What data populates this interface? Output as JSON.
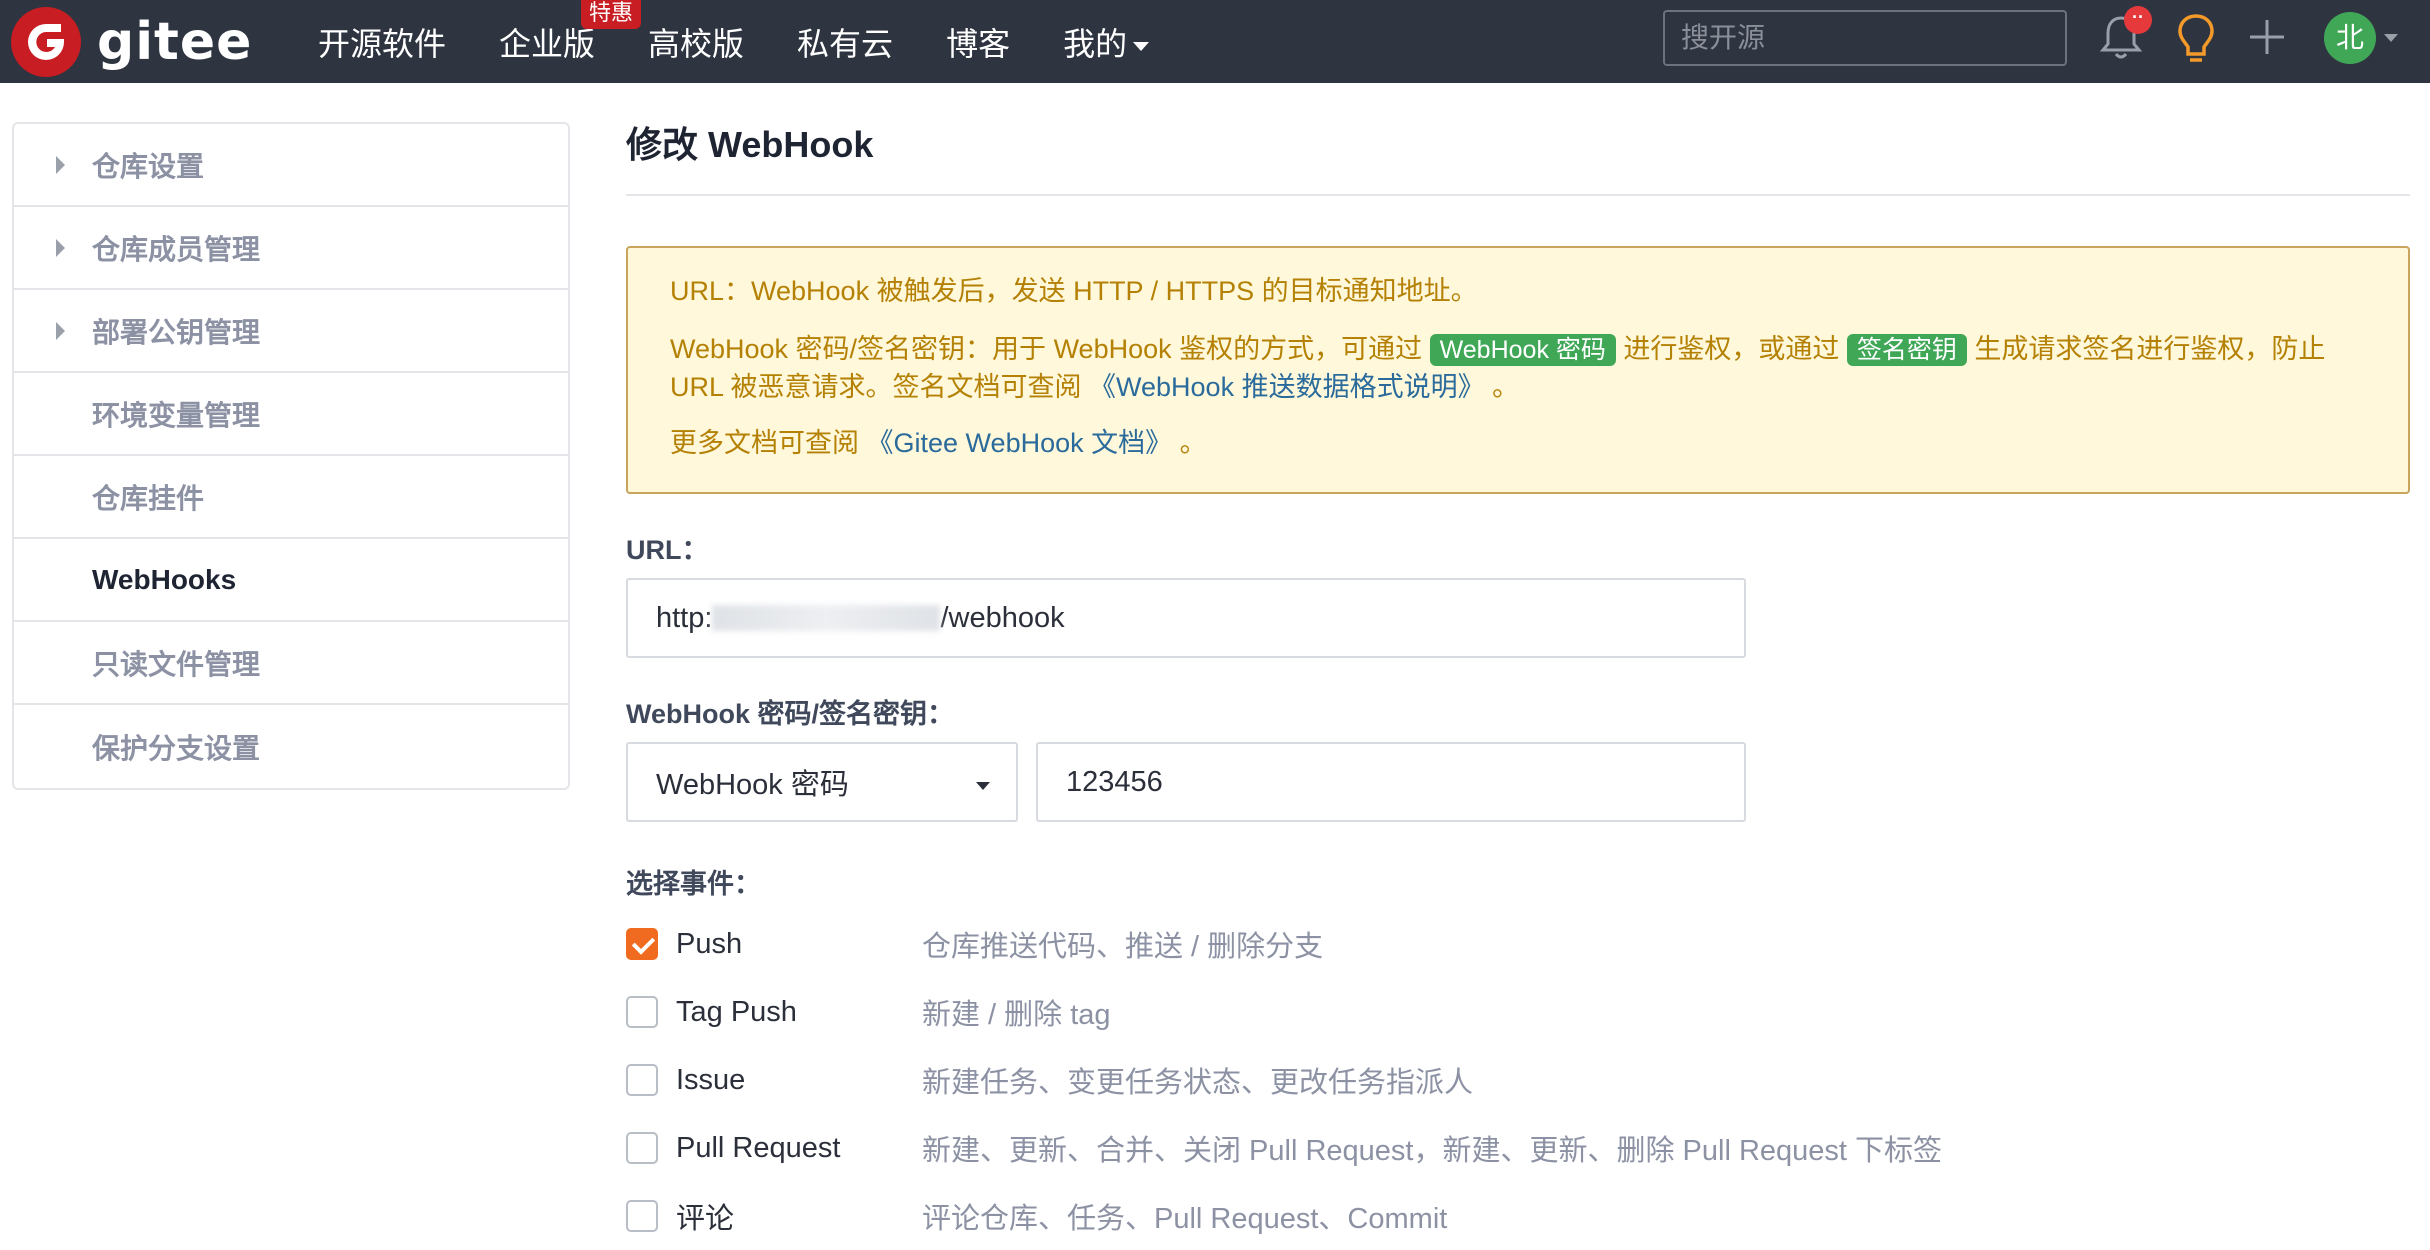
{
  "brand": {
    "name": "gitee"
  },
  "nav": {
    "items": [
      "开源软件",
      "企业版",
      "高校版",
      "私有云",
      "博客"
    ],
    "badge": "特惠",
    "mine": "我的"
  },
  "search": {
    "placeholder": "搜开源"
  },
  "notifications": {
    "dot": "··"
  },
  "user": {
    "avatar_text": "北"
  },
  "icons": {
    "bell": "bell-icon",
    "bulb": "lightbulb-icon",
    "plus": "plus-icon",
    "caret": "caret-down-icon",
    "arrow": "caret-right-icon"
  },
  "colors": {
    "brand": "#c71d23",
    "topbar": "#2e3440",
    "accent": "#f06b1f",
    "tag": "#3fa756",
    "notice_bg": "#fff8db",
    "notice_text": "#b58105",
    "link": "#2a6b9c"
  },
  "sidebar": {
    "items": [
      {
        "label": "仓库设置"
      },
      {
        "label": "仓库成员管理"
      },
      {
        "label": "部署公钥管理"
      },
      {
        "label": "环境变量管理"
      },
      {
        "label": "仓库挂件"
      },
      {
        "label": "WebHooks"
      },
      {
        "label": "只读文件管理"
      },
      {
        "label": "保护分支设置"
      }
    ]
  },
  "page": {
    "title": "修改 WebHook"
  },
  "notice": {
    "line1": "URL：WebHook 被触发后，发送 HTTP / HTTPS 的目标通知地址。",
    "line2_a": "WebHook 密码/签名密钥：用于 WebHook 鉴权的方式，可通过 ",
    "tag1": "WebHook 密码",
    "line2_b": " 进行鉴权，或通过 ",
    "tag2": "签名密钥",
    "line2_c": " 生成请求签名进行鉴权，防止 URL 被恶意请求。签名文档可查阅 ",
    "link1": "《WebHook 推送数据格式说明》",
    "line2_d": " 。",
    "line3_a": "更多文档可查阅 ",
    "link2": "《Gitee WebHook 文档》",
    "line3_b": " 。"
  },
  "form": {
    "url_label": "URL：",
    "url_prefix": "http:",
    "url_suffix": "/webhook",
    "secret_label": "WebHook 密码/签名密钥：",
    "secret_type": "WebHook 密码",
    "secret_value": "123456",
    "events_label": "选择事件："
  },
  "events": [
    {
      "name": "Push",
      "desc": "仓库推送代码、推送 / 删除分支",
      "checked": true
    },
    {
      "name": "Tag Push",
      "desc": "新建 / 删除 tag",
      "checked": false
    },
    {
      "name": "Issue",
      "desc": "新建任务、变更任务状态、更改任务指派人",
      "checked": false
    },
    {
      "name": "Pull Request",
      "desc": "新建、更新、合并、关闭 Pull Request，新建、更新、删除 Pull Request 下标签",
      "checked": false
    },
    {
      "name": "评论",
      "desc": "评论仓库、任务、Pull Request、Commit",
      "checked": false
    }
  ]
}
